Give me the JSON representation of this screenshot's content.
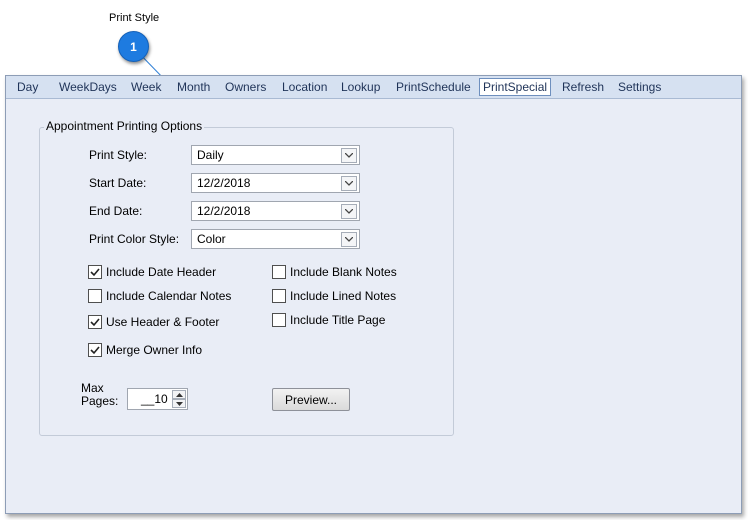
{
  "callout": {
    "label": "Print Style",
    "number": "1"
  },
  "tabs": [
    {
      "label": "Day"
    },
    {
      "label": "WeekDays"
    },
    {
      "label": "Week"
    },
    {
      "label": "Month"
    },
    {
      "label": "Owners"
    },
    {
      "label": "Location"
    },
    {
      "label": "Lookup"
    },
    {
      "label": "PrintSchedule"
    },
    {
      "label": "PrintSpecial",
      "active": true
    },
    {
      "label": "Refresh"
    },
    {
      "label": "Settings"
    }
  ],
  "group": {
    "title": "Appointment Printing Options",
    "fields": [
      {
        "label": "Print Style:",
        "value": "Daily"
      },
      {
        "label": "Start Date:",
        "value": "12/2/2018"
      },
      {
        "label": "End Date:",
        "value": "12/2/2018"
      },
      {
        "label": "Print Color Style:",
        "value": "Color"
      }
    ],
    "checkboxes": [
      {
        "label": "Include Date Header",
        "checked": true
      },
      {
        "label": "Include Blank Notes",
        "checked": false
      },
      {
        "label": "Include Calendar Notes",
        "checked": false
      },
      {
        "label": "Include Lined Notes",
        "checked": false
      },
      {
        "label": "Use Header & Footer",
        "checked": true
      },
      {
        "label": "Include Title Page",
        "checked": false
      },
      {
        "label": "Merge Owner Info",
        "checked": true
      }
    ],
    "max_pages": {
      "label_line1": "Max",
      "label_line2": "Pages:",
      "value": "__10"
    },
    "preview_label": "Preview..."
  },
  "icons": {
    "dropdown": "chevron-down-icon",
    "check": "check-icon",
    "up": "arrow-up-icon",
    "down": "arrow-down-icon"
  }
}
